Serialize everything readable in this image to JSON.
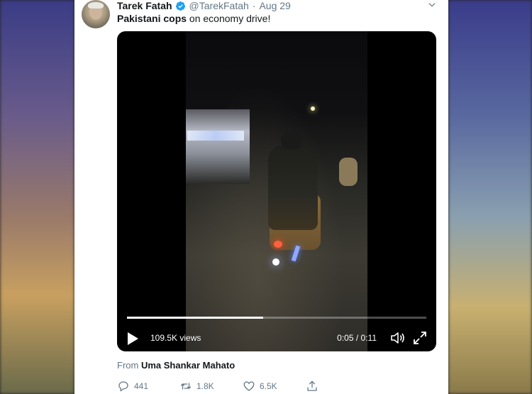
{
  "tweet": {
    "author_name": "Tarek Fatah",
    "handle": "@TarekFatah",
    "separator": "·",
    "date": "Aug 29",
    "text_bold": "Pakistani cops",
    "text_rest": " on economy drive!",
    "verified_color": "#1da1f2"
  },
  "video": {
    "views": "109.5K views",
    "time": "0:05 / 0:11",
    "progress": 0.455,
    "icons": [
      "play-icon",
      "volume-icon",
      "fullscreen-icon"
    ]
  },
  "attribution": {
    "prefix": "From",
    "source": "Uma Shankar Mahato"
  },
  "actions": {
    "reply_count": "441",
    "retweet_count": "1.8K",
    "like_count": "6.5K"
  }
}
